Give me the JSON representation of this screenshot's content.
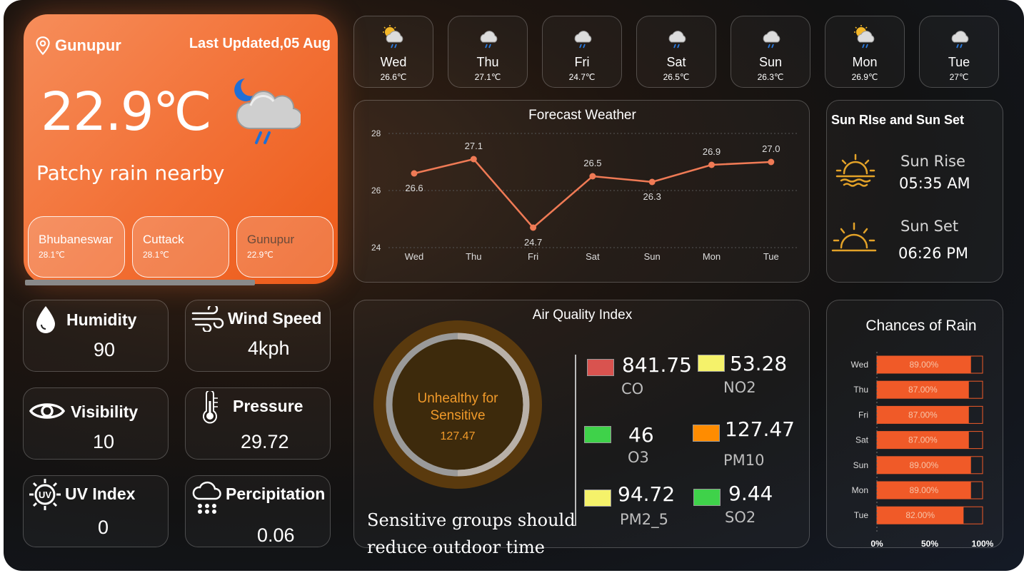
{
  "current": {
    "location": "Gunupur",
    "updated_label": "Last Updated,05 Aug",
    "temperature": "22.9℃",
    "condition": "Patchy rain nearby",
    "icon": "night-rain-cloud-icon"
  },
  "cities": [
    {
      "name": "Bhubaneswar",
      "temp": "28.1℃"
    },
    {
      "name": "Cuttack",
      "temp": "28.1℃"
    },
    {
      "name": "Gunupur",
      "temp": "22.9℃"
    }
  ],
  "stats": {
    "humidity": {
      "label": "Humidity",
      "value": "90"
    },
    "wind": {
      "label": "Wind Speed",
      "value": "4kph"
    },
    "visibility": {
      "label": "Visibility",
      "value": "10"
    },
    "pressure": {
      "label": "Pressure",
      "value": "29.72"
    },
    "uv": {
      "label": "UV Index",
      "value": "0"
    },
    "precip": {
      "label": "Percipitation",
      "value": "0.06"
    }
  },
  "days": [
    {
      "name": "Wed",
      "temp": "26.6℃",
      "icon": "sun-cloud-rain-icon"
    },
    {
      "name": "Thu",
      "temp": "27.1℃",
      "icon": "cloud-rain-icon"
    },
    {
      "name": "Fri",
      "temp": "24.7℃",
      "icon": "cloud-rain-icon"
    },
    {
      "name": "Sat",
      "temp": "26.5℃",
      "icon": "cloud-rain-icon"
    },
    {
      "name": "Sun",
      "temp": "26.3℃",
      "icon": "cloud-rain-icon"
    },
    {
      "name": "Mon",
      "temp": "26.9℃",
      "icon": "sun-cloud-rain-icon"
    },
    {
      "name": "Tue",
      "temp": "27℃",
      "icon": "cloud-rain-icon"
    }
  ],
  "forecast_chart": {
    "title": "Forecast Weather",
    "type": "line",
    "categories": [
      "Wed",
      "Thu",
      "Fri",
      "Sat",
      "Sun",
      "Mon",
      "Tue"
    ],
    "values": [
      26.6,
      27.1,
      24.7,
      26.5,
      26.3,
      26.9,
      27.0
    ],
    "labels": [
      "26.6",
      "27.1",
      "24.7",
      "26.5",
      "26.3",
      "26.9",
      "27.0"
    ],
    "yticks": [
      "24",
      "26",
      "28"
    ],
    "ylim": [
      24,
      28
    ],
    "color": "#ef7a55"
  },
  "sun": {
    "title": "Sun RIse and Sun Set",
    "rise_label": "Sun Rise",
    "rise_time": "05:35 AM",
    "set_label": "Sun Set",
    "set_time": "06:26 PM",
    "icon_color": "#e3a228"
  },
  "aqi": {
    "title": "Air Quality Index",
    "status": "Unhealthy for Sensitive",
    "value": "127.47",
    "advice": "Sensitive groups should reduce outdoor time",
    "items": [
      {
        "name": "CO",
        "value": "841.75",
        "color": "#d9534f"
      },
      {
        "name": "NO2",
        "value": "53.28",
        "color": "#f5f26a"
      },
      {
        "name": "O3",
        "value": "46",
        "color": "#3fd24a"
      },
      {
        "name": "PM10",
        "value": "127.47",
        "color": "#ff8c00"
      },
      {
        "name": "PM2_5",
        "value": "94.72",
        "color": "#f5f26a"
      },
      {
        "name": "SO2",
        "value": "9.44",
        "color": "#3fd24a"
      }
    ]
  },
  "chart_data": {
    "type": "bar",
    "title": "Chances of Rain",
    "categories": [
      "Wed",
      "Thu",
      "Fri",
      "Sat",
      "Sun",
      "Mon",
      "Tue"
    ],
    "values": [
      89,
      87,
      87,
      87,
      89,
      89,
      82
    ],
    "labels": [
      "89.00%",
      "87.00%",
      "87.00%",
      "87.00%",
      "89.00%",
      "89.00%",
      "82.00%"
    ],
    "xticks": [
      "0%",
      "50%",
      "100%"
    ],
    "xlim": [
      0,
      100
    ],
    "color": "#f05a28"
  }
}
